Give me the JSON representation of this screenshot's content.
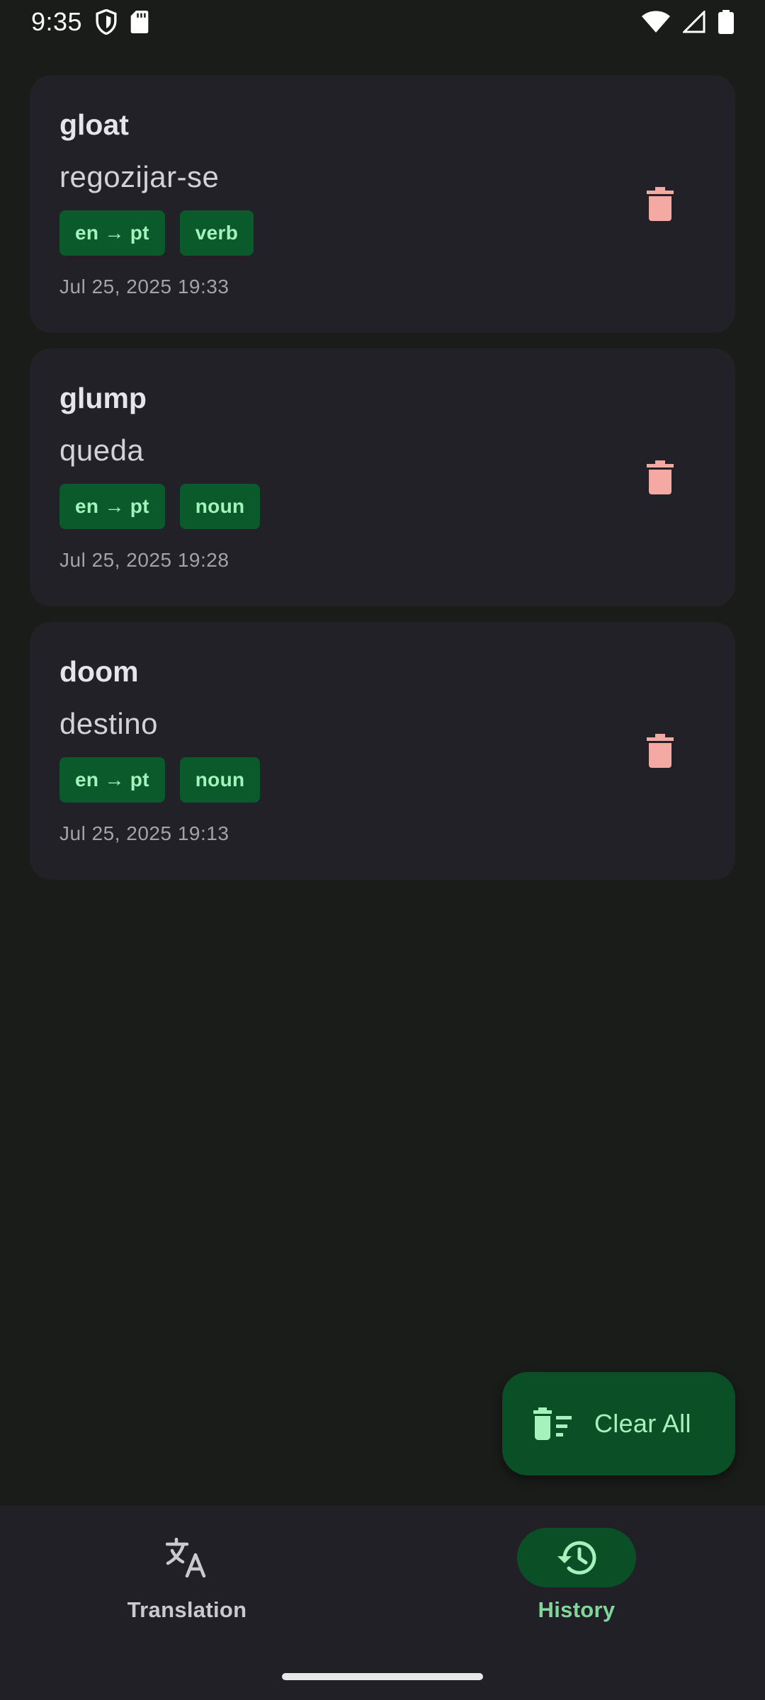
{
  "status_bar": {
    "time": "9:35",
    "left_icons": [
      "shield-icon",
      "sd-card-icon"
    ],
    "right_icons": [
      "wifi-icon",
      "signal-icon",
      "battery-icon"
    ]
  },
  "history": {
    "items": [
      {
        "word": "gloat",
        "translation": "regozijar-se",
        "language_pair": "en → pt",
        "part_of_speech": "verb",
        "date": "Jul 25, 2025 19:33",
        "delete_icon": "trash-icon"
      },
      {
        "word": "glump",
        "translation": "queda",
        "language_pair": "en → pt",
        "part_of_speech": "noun",
        "date": "Jul 25, 2025 19:28",
        "delete_icon": "trash-icon"
      },
      {
        "word": "doom",
        "translation": "destino",
        "language_pair": "en → pt",
        "part_of_speech": "noun",
        "date": "Jul 25, 2025 19:13",
        "delete_icon": "trash-icon"
      }
    ]
  },
  "fab": {
    "label": "Clear All",
    "icon": "delete-sweep-icon"
  },
  "bottom_nav": {
    "items": [
      {
        "label": "Translation",
        "icon": "translate-icon",
        "selected": false
      },
      {
        "label": "History",
        "icon": "history-icon",
        "selected": true
      }
    ]
  },
  "colors": {
    "background": "#1a1c1a",
    "card": "#222128",
    "chip_bg": "#0b5a2c",
    "chip_text": "#a6f2bc",
    "delete": "#f4aaa3",
    "fab_bg": "#0b4f27",
    "nav_bg": "#212027",
    "nav_selected": "#7fd89a"
  }
}
